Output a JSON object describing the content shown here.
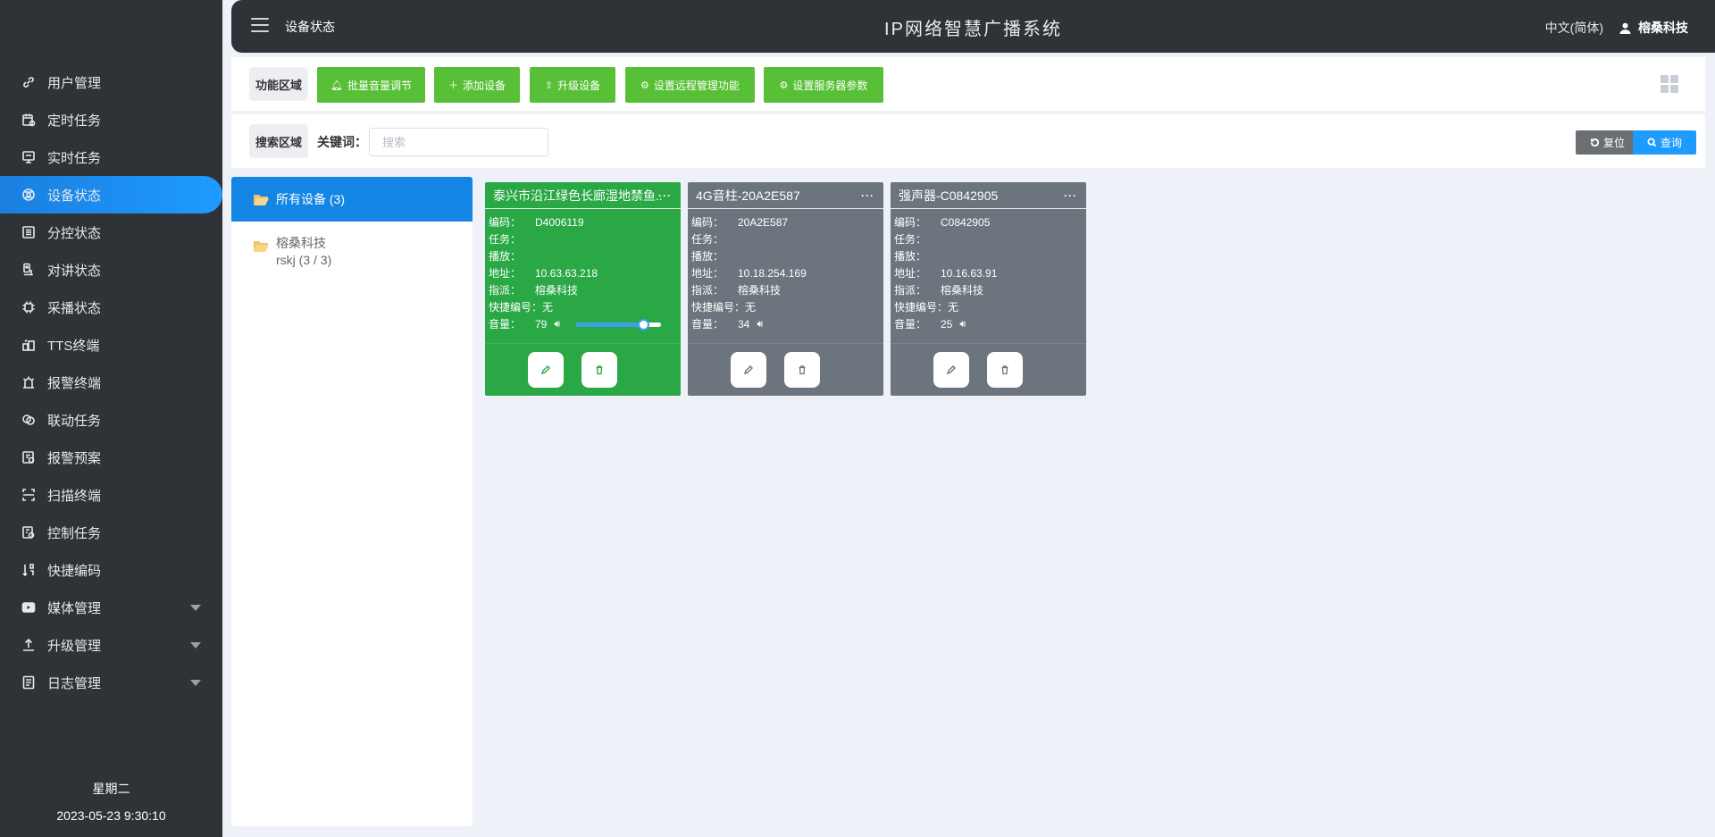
{
  "header": {
    "page_name": "设备状态",
    "app_title": "IP网络智慧广播系统",
    "language": "中文(简体)",
    "user": "榕桑科技"
  },
  "sidebar": {
    "items": [
      {
        "label": "用户管理",
        "icon": "link-icon"
      },
      {
        "label": "定时任务",
        "icon": "calendar-icon"
      },
      {
        "label": "实时任务",
        "icon": "monitor-icon"
      },
      {
        "label": "设备状态",
        "icon": "device-icon",
        "active": true
      },
      {
        "label": "分控状态",
        "icon": "list-icon"
      },
      {
        "label": "对讲状态",
        "icon": "intercom-icon"
      },
      {
        "label": "采播状态",
        "icon": "chip-icon"
      },
      {
        "label": "TTS终端",
        "icon": "tts-icon"
      },
      {
        "label": "报警终端",
        "icon": "alarm-icon"
      },
      {
        "label": "联动任务",
        "icon": "linkage-icon"
      },
      {
        "label": "报警预案",
        "icon": "plan-icon"
      },
      {
        "label": "扫描终端",
        "icon": "scan-icon"
      },
      {
        "label": "控制任务",
        "icon": "control-icon"
      },
      {
        "label": "快捷编码",
        "icon": "sort-icon"
      },
      {
        "label": "媒体管理",
        "icon": "media-icon",
        "expandable": true
      },
      {
        "label": "升级管理",
        "icon": "upload-icon",
        "expandable": true
      },
      {
        "label": "日志管理",
        "icon": "log-icon",
        "expandable": true
      }
    ],
    "weekday": "星期二",
    "datetime": "2023-05-23 9:30:10"
  },
  "function_area": {
    "label": "功能区域",
    "buttons": [
      "批量音量调节",
      "添加设备",
      "升级设备",
      "设置远程管理功能",
      "设置服务器参数"
    ]
  },
  "search_area": {
    "label": "搜索区域",
    "keyword_label": "关键词：",
    "placeholder": "搜索",
    "reset_label": "复位",
    "query_label": "查询"
  },
  "tree": {
    "root": "所有设备 (3)",
    "children": [
      {
        "name": "榕桑科技",
        "sub": "rskj (3 / 3)"
      }
    ]
  },
  "field_labels": {
    "code": "编码：",
    "task": "任务：",
    "play": "播放：",
    "address": "地址：",
    "assign": "指派：",
    "quick": "快捷编号：",
    "volume": "音量："
  },
  "devices": [
    {
      "title": "泰兴市沿江绿色长廊湿地禁鱼...",
      "code": "D4006119",
      "task": "",
      "play": "",
      "address": "10.63.63.218",
      "assign": "榕桑科技",
      "quick": "无",
      "volume": "79",
      "volume_level": 0.79,
      "status_color": "#2aa845",
      "online": true
    },
    {
      "title": "4G音柱-20A2E587",
      "code": "20A2E587",
      "task": "",
      "play": "",
      "address": "10.18.254.169",
      "assign": "榕桑科技",
      "quick": "无",
      "volume": "34",
      "status_color": "#6c757d",
      "online": false
    },
    {
      "title": "强声器-C0842905",
      "code": "C0842905",
      "task": "",
      "play": "",
      "address": "10.16.63.91",
      "assign": "榕桑科技",
      "quick": "无",
      "volume": "25",
      "status_color": "#6c757d",
      "online": false
    }
  ]
}
